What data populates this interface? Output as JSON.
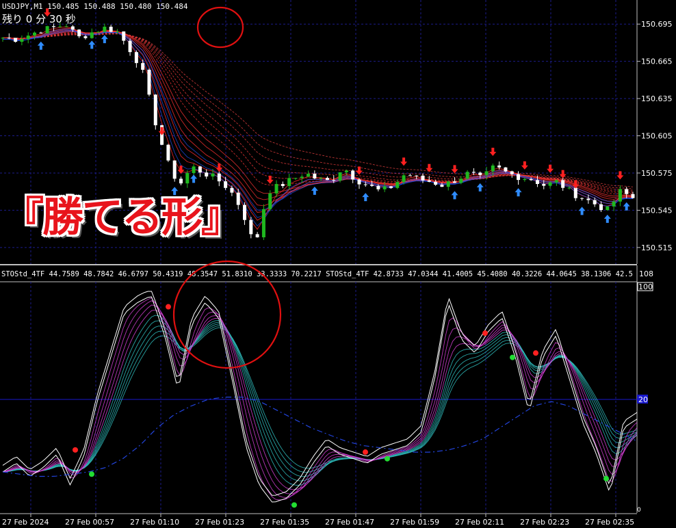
{
  "chart_data": [
    {
      "type": "candlestick",
      "symbol_header": "USDJPY,M1  150.485 150.488 150.480 150.484",
      "countdown": "残り 0 分 30 秒",
      "y_ticks": [
        "150.695",
        "150.665",
        "150.635",
        "150.605",
        "150.575",
        "150.545",
        "150.515"
      ],
      "ylim": [
        150.505,
        150.71
      ],
      "close_path": [
        150.684,
        150.683,
        150.686,
        150.69,
        150.692,
        150.695,
        150.684,
        150.688,
        150.692,
        150.69,
        150.676,
        150.66,
        150.62,
        150.585,
        150.565,
        150.58,
        150.575,
        150.57,
        150.562,
        150.545,
        150.515,
        150.56,
        150.565,
        150.57,
        150.575,
        150.57,
        150.568,
        150.58,
        150.57,
        150.565,
        150.56,
        150.565,
        150.575,
        150.57,
        150.568,
        150.565,
        150.57,
        150.575,
        150.57,
        150.58,
        150.575,
        150.572,
        150.57,
        150.565,
        150.568,
        150.56,
        150.555,
        150.55,
        150.545,
        150.56,
        150.555
      ]
    },
    {
      "type": "line",
      "indicator_header": "STOStd_4TF 44.7589 48.7842 46.6797 50.4319 48.3547 51.8310 33.3333 70.2217   STOStd_4TF 42.8733 47.0344 41.4005 45.4080 40.3226 44.0645 38.1306 42.5",
      "ylim": [
        0,
        100
      ],
      "y_ticks": [
        "108",
        "100",
        "20",
        "0"
      ],
      "main_line": [
        18,
        22,
        16,
        20,
        26,
        12,
        25,
        50,
        70,
        90,
        95,
        98,
        80,
        55,
        85,
        95,
        88,
        60,
        30,
        12,
        4,
        6,
        12,
        22,
        30,
        26,
        24,
        22,
        26,
        28,
        30,
        36,
        60,
        95,
        78,
        72,
        82,
        88,
        70,
        45,
        70,
        80,
        60,
        40,
        26,
        8,
        38,
        42
      ],
      "baseline_line": [
        18,
        17,
        16,
        16,
        17,
        18,
        20,
        24,
        30,
        38,
        44,
        48,
        51,
        52,
        52,
        50,
        46,
        42,
        38,
        35,
        32,
        30,
        29,
        28,
        27,
        27,
        28,
        30,
        33,
        38,
        43,
        48,
        50,
        48,
        44,
        40,
        36,
        32
      ]
    }
  ],
  "overlay": {
    "title": "『勝てる形』"
  },
  "x_axis": {
    "labels": [
      "27 Feb 2024",
      "27 Feb 00:57",
      "27 Feb 01:10",
      "27 Feb 01:23",
      "27 Feb 01:35",
      "27 Feb 01:47",
      "27 Feb 01:59",
      "27 Feb 02:11",
      "27 Feb 02:23",
      "27 Feb 02:35"
    ]
  },
  "colors": {
    "background": "#000000",
    "grid": "#1c1c8c",
    "bull": "#1fb81f",
    "bear": "#ffffff",
    "arrow_up": "#2f8cff",
    "arrow_down": "#ff2020",
    "ribbon_fast": "#ff3333",
    "ribbon_slow": "#2255ff",
    "stoch_magenta": "#d63fd6",
    "stoch_teal": "#2fbfbf",
    "stoch_main": "#ffffff",
    "level_line": "#1818cc",
    "marker_red": "#ff2020",
    "marker_green": "#22dd33",
    "circle": "#e01010"
  },
  "level_label": "20"
}
